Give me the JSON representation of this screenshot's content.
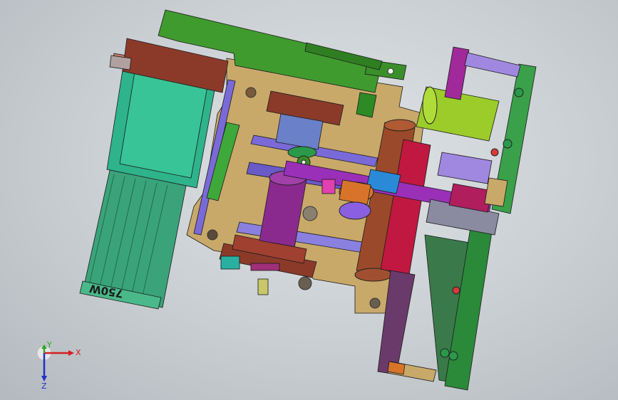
{
  "viewport": {
    "background_color": "#c9ced2"
  },
  "model": {
    "motor_label": "750W",
    "colors": {
      "plate": "#c8a96a",
      "motor_body": "#3aa37a",
      "motor_face": "#2eb38a",
      "green_bar": "#3f9b2e",
      "brown": "#8b3a2a",
      "purple": "#8a2a8e",
      "violet": "#7a6ad8",
      "lime": "#9ccc2a",
      "orange": "#d8742a",
      "magenta": "#b01e5e"
    }
  },
  "triad": {
    "x_label": "X",
    "y_label": "Y",
    "z_label": "Z",
    "x_color": "#d42020",
    "y_color": "#2aa82a",
    "z_color": "#2030c8"
  }
}
